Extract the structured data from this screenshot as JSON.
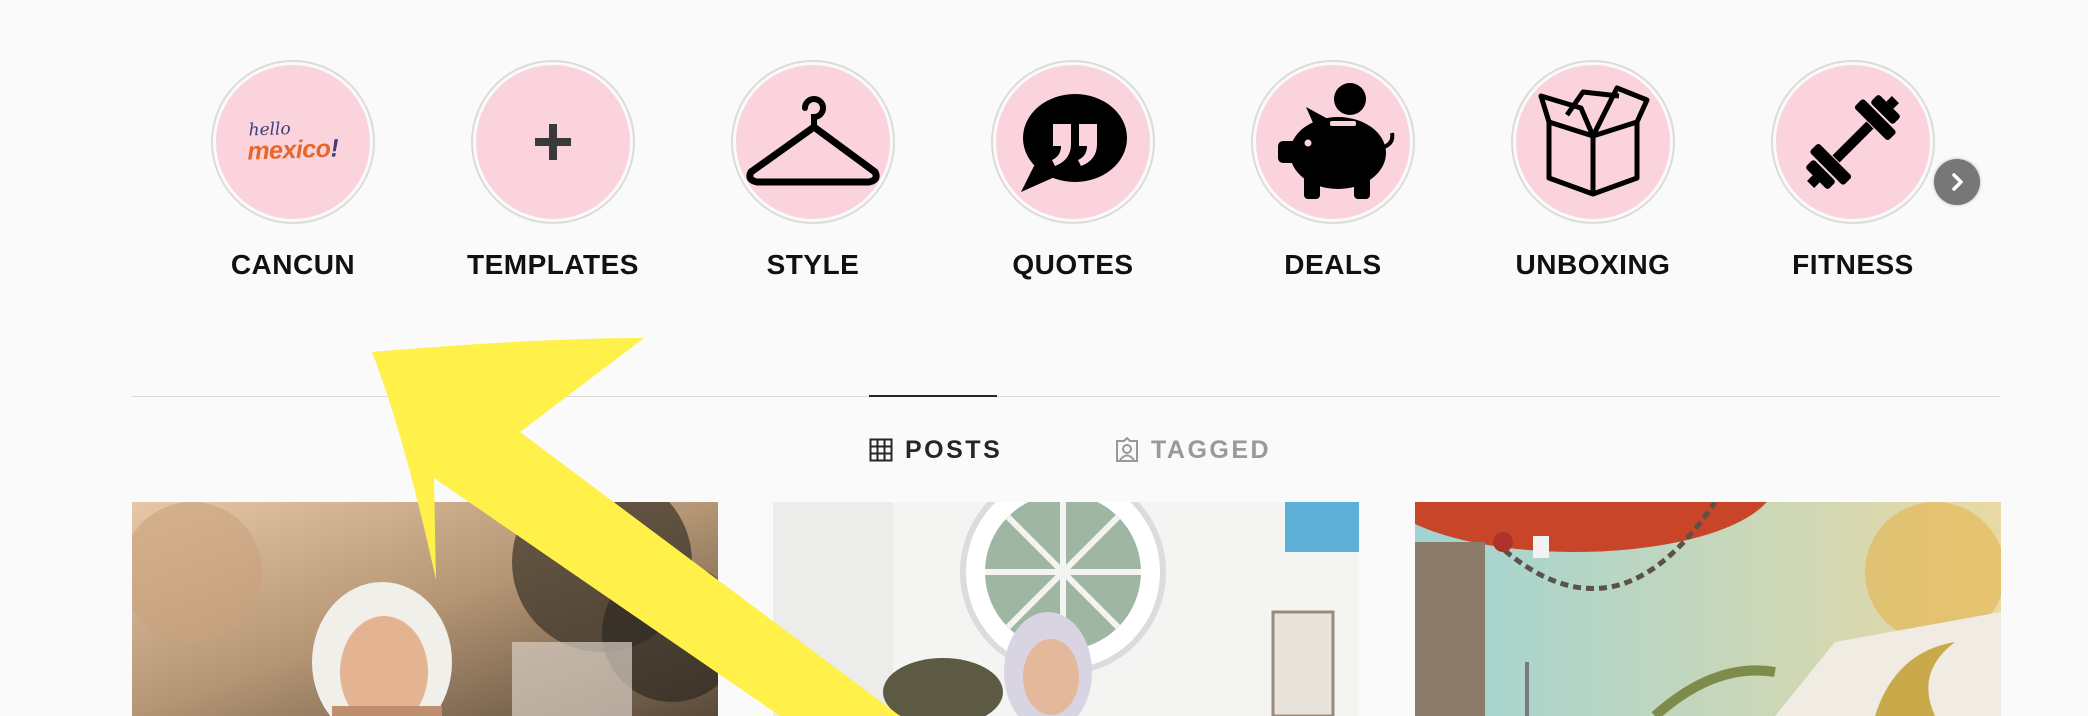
{
  "highlights": [
    {
      "label": "CANCUN",
      "icon": "hello-mexico-logo",
      "logo_text_top": "hello",
      "logo_text_bottom": "mexico",
      "logo_mark": "!"
    },
    {
      "label": "TEMPLATES",
      "icon": "plus-icon"
    },
    {
      "label": "STYLE",
      "icon": "hanger-icon"
    },
    {
      "label": "QUOTES",
      "icon": "speech-quote-icon"
    },
    {
      "label": "DEALS",
      "icon": "piggy-bank-icon"
    },
    {
      "label": "UNBOXING",
      "icon": "open-box-icon"
    },
    {
      "label": "FITNESS",
      "icon": "dumbbell-icon"
    }
  ],
  "highlights_next_icon": "chevron-right-icon",
  "tabs": [
    {
      "label": "POSTS",
      "icon": "grid-icon",
      "active": true
    },
    {
      "label": "TAGGED",
      "icon": "tagged-person-icon",
      "active": false
    }
  ],
  "posts": [
    {
      "description": "photo"
    },
    {
      "description": "photo"
    },
    {
      "description": "photo"
    }
  ],
  "annotation_arrow_color": "#fff04a",
  "highlight_color": "#fad3dd"
}
